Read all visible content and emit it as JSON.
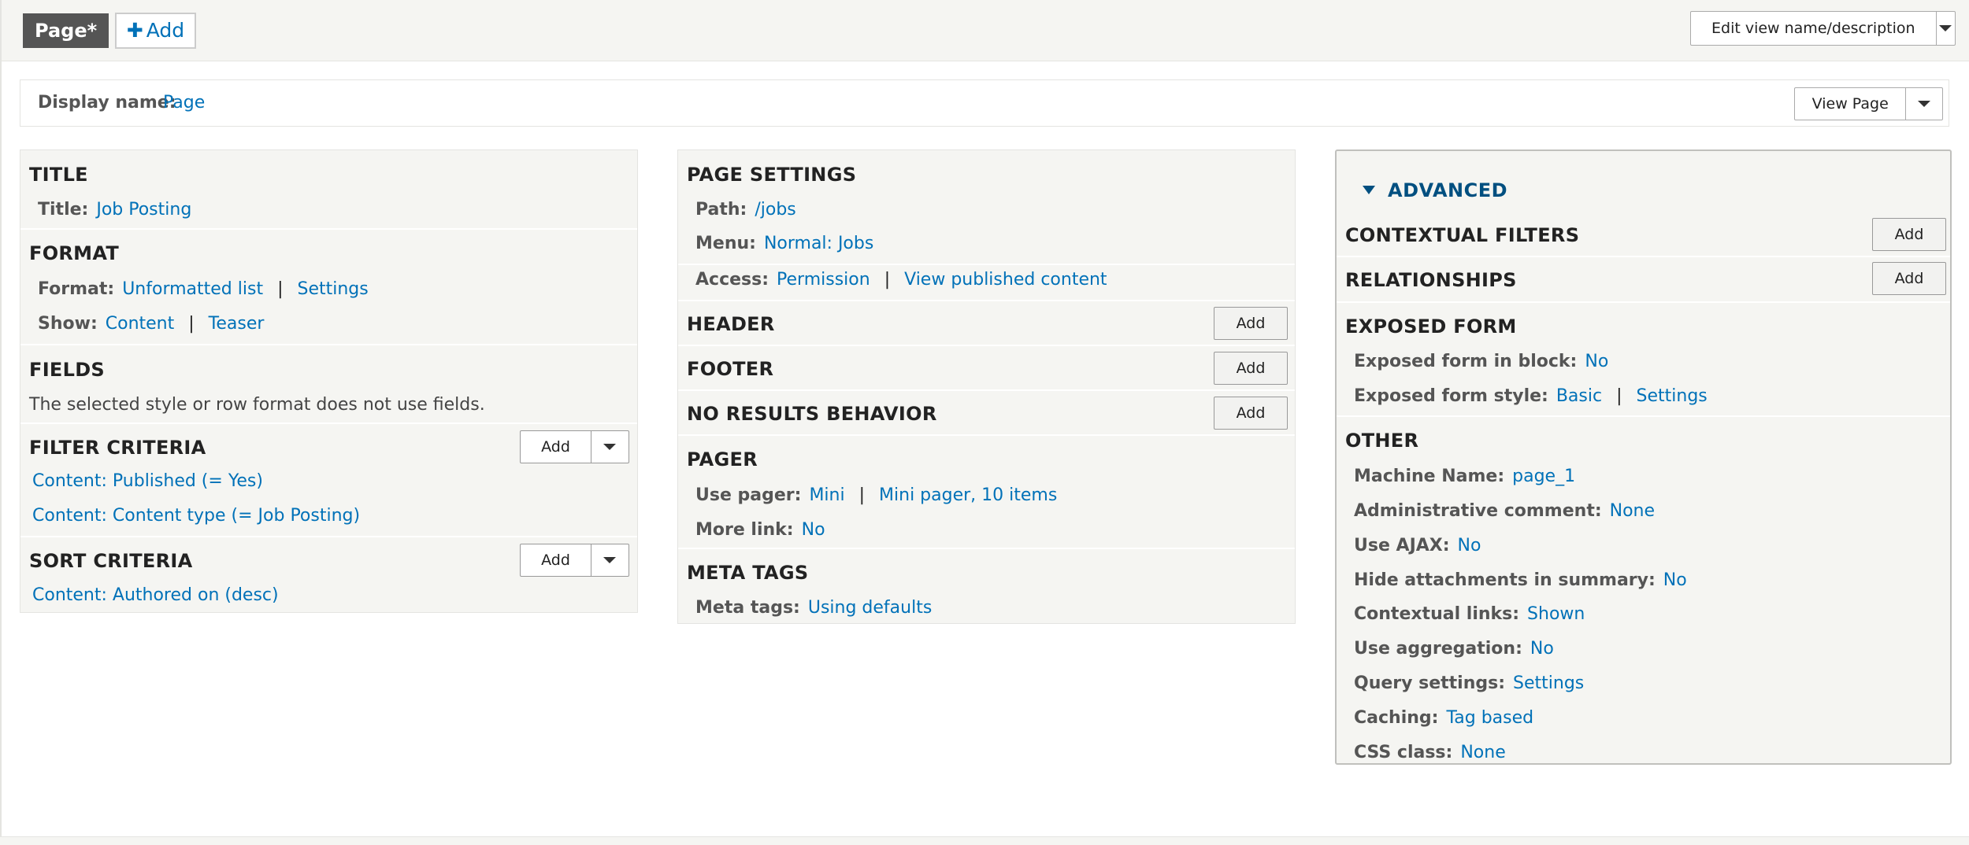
{
  "top": {
    "page_tab": "Page*",
    "add_tab": "Add",
    "edit_button": "Edit view name/description"
  },
  "display": {
    "label": "Display name:",
    "value": "Page",
    "view_button": "View Page"
  },
  "col1": {
    "title": {
      "heading": "TITLE",
      "title_label": "Title:",
      "title_value": "Job Posting"
    },
    "format": {
      "heading": "FORMAT",
      "format_label": "Format:",
      "format_value": "Unformatted list",
      "format_settings": "Settings",
      "show_label": "Show:",
      "show_value": "Content",
      "show_settings": "Teaser"
    },
    "fields": {
      "heading": "FIELDS",
      "note": "The selected style or row format does not use fields."
    },
    "filter": {
      "heading": "FILTER CRITERIA",
      "add": "Add",
      "items": [
        "Content: Published (= Yes)",
        "Content: Content type (= Job Posting)"
      ]
    },
    "sort": {
      "heading": "SORT CRITERIA",
      "add": "Add",
      "items": [
        "Content: Authored on (desc)"
      ]
    }
  },
  "col2": {
    "page_settings": {
      "heading": "PAGE SETTINGS",
      "path_label": "Path:",
      "path_value": "/jobs",
      "menu_label": "Menu:",
      "menu_value": "Normal: Jobs",
      "access_label": "Access:",
      "access_value": "Permission",
      "access_settings": "View published content"
    },
    "header": {
      "heading": "HEADER",
      "add": "Add"
    },
    "footer": {
      "heading": "FOOTER",
      "add": "Add"
    },
    "no_results": {
      "heading": "NO RESULTS BEHAVIOR",
      "add": "Add"
    },
    "pager": {
      "heading": "PAGER",
      "use_label": "Use pager:",
      "use_value": "Mini",
      "use_settings": "Mini pager, 10 items",
      "more_label": "More link:",
      "more_value": "No"
    },
    "meta": {
      "heading": "META TAGS",
      "label": "Meta tags:",
      "value": "Using defaults"
    }
  },
  "col3": {
    "advanced": "ADVANCED",
    "contextual": {
      "heading": "CONTEXTUAL FILTERS",
      "add": "Add"
    },
    "relationships": {
      "heading": "RELATIONSHIPS",
      "add": "Add"
    },
    "exposed": {
      "heading": "EXPOSED FORM",
      "block_label": "Exposed form in block:",
      "block_value": "No",
      "style_label": "Exposed form style:",
      "style_value": "Basic",
      "style_settings": "Settings"
    },
    "other": {
      "heading": "OTHER",
      "rows": [
        {
          "label": "Machine Name:",
          "value": "page_1"
        },
        {
          "label": "Administrative comment:",
          "value": "None"
        },
        {
          "label": "Use AJAX:",
          "value": "No"
        },
        {
          "label": "Hide attachments in summary:",
          "value": "No"
        },
        {
          "label": "Contextual links:",
          "value": "Shown"
        },
        {
          "label": "Use aggregation:",
          "value": "No"
        },
        {
          "label": "Query settings:",
          "value": "Settings"
        },
        {
          "label": "Caching:",
          "value": "Tag based"
        },
        {
          "label": "CSS class:",
          "value": "None"
        }
      ]
    }
  }
}
